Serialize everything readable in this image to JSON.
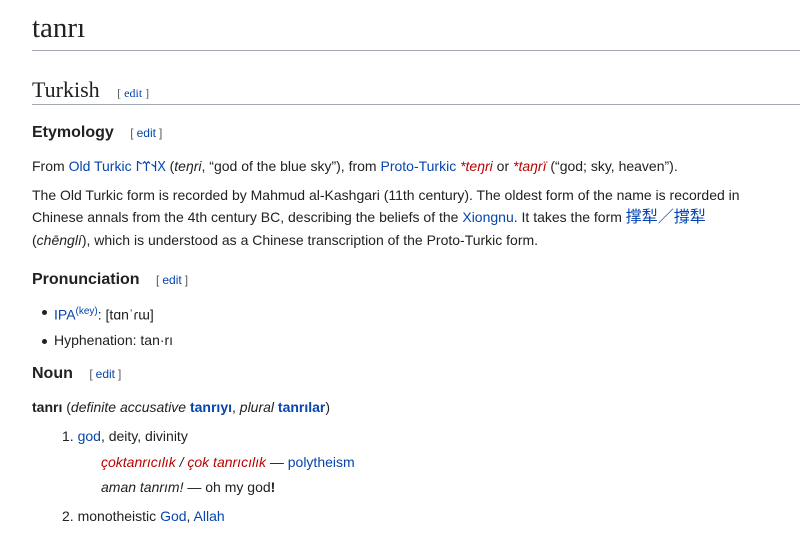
{
  "page": {
    "title": "tanrı"
  },
  "sections": {
    "language": {
      "title": "Turkish",
      "edit": "edit"
    },
    "etymology": {
      "title": "Etymology",
      "edit": "edit",
      "p1": {
        "from": "From ",
        "old_turkic_link": "Old Turkic",
        "old_turkic_script": "𐰓𐰭𐰼𐰃",
        "paren_open": " (",
        "tengri": "teŋri",
        "gloss1": ", “god of the blue sky”), from ",
        "proto_turkic_link": "Proto-Turkic",
        "sp": " ",
        "recon1": "*teŋri",
        "or": " or ",
        "recon2": "*taŋrï",
        "gloss2": " (“god; sky, heaven”)."
      },
      "p2": {
        "text1": "The Old Turkic form is recorded by Mahmud al-Kashgari (11th century). The oldest form of the name is recorded in Chinese annals from the 4th century BC, describing the beliefs of the ",
        "xiongnu": "Xiongnu",
        "text2": ". It takes the form ",
        "han": "撑犁／撐犁",
        "paren_open": "(",
        "chengli": "chēnglí",
        "text3": "), which is understood as a Chinese transcription of the Proto-Turkic form."
      }
    },
    "pronunciation": {
      "title": "Pronunciation",
      "edit": "edit",
      "ipa_link": "IPA",
      "key": "(key)",
      "ipa_value": ": [tɑnˈɾɯ]",
      "hyphenation": "Hyphenation: tan·rı"
    },
    "noun": {
      "title": "Noun",
      "edit": "edit",
      "headword": "tanrı",
      "paren_open": " (",
      "def_acc_label": "definite accusative",
      "sp": " ",
      "def_acc_form": "tanrıyı",
      "comma": ", ",
      "plural_label": "plural",
      "plural_form": "tanrılar",
      "paren_close": ")",
      "senses": [
        {
          "num": "1.",
          "link": "god",
          "rest": ", deity, divinity",
          "examples": {
            "e1a": "çoktanrıcılık",
            "sep": " / ",
            "e1b": "çok tanrıcılık",
            "dash": " — ",
            "e1c": "polytheism",
            "e2a": "aman tanrım!",
            "e2b": " — oh my god",
            "e2c": "!"
          }
        },
        {
          "num": "2.",
          "text": "monotheistic ",
          "link1": "God",
          "comma": ", ",
          "link2": "Allah"
        }
      ]
    }
  }
}
